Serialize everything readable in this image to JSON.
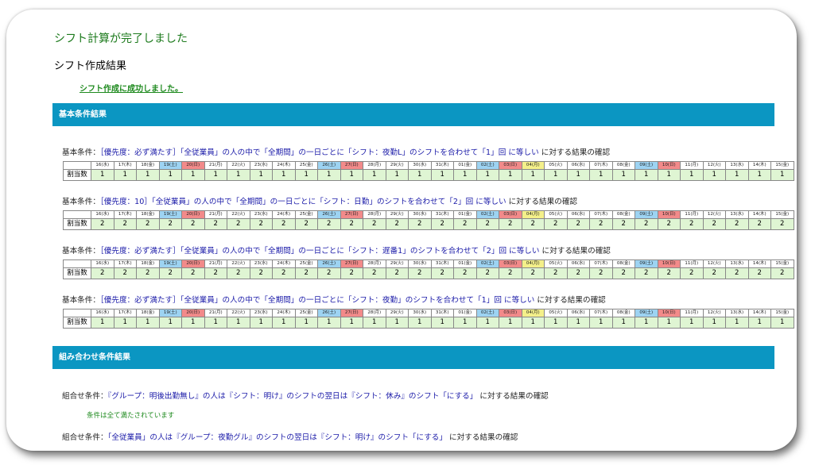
{
  "header": {
    "done": "シフト計算が完了しました",
    "result_title": "シフト作成結果",
    "success_link": "シフト作成に成功しました。"
  },
  "sections": {
    "basic": "基本条件結果",
    "combo": "組み合わせ条件結果"
  },
  "row_label": "割当数",
  "dates": [
    "16(水)",
    "17(木)",
    "18(金)",
    "19(土)",
    "20(日)",
    "21(月)",
    "22(火)",
    "23(水)",
    "24(木)",
    "25(金)",
    "26(土)",
    "27(日)",
    "28(月)",
    "29(火)",
    "30(水)",
    "31(木)",
    "01(金)",
    "02(土)",
    "03(日)",
    "04(月)",
    "05(火)",
    "06(水)",
    "07(木)",
    "08(金)",
    "09(土)",
    "10(日)",
    "11(月)",
    "12(火)",
    "13(水)",
    "14(木)",
    "15(金)"
  ],
  "day_colors": {
    "sat": [
      3,
      10,
      17,
      24
    ],
    "sun": [
      4,
      11,
      18,
      25
    ],
    "hol": [
      19
    ]
  },
  "colors": {
    "banner": "#0b96c2",
    "sat": "#9dd3f2",
    "sun": "#f28a8a",
    "holiday": "#f4f08a",
    "cell": "#dff5d3"
  },
  "basic_conditions": [
    {
      "prefix": "基本条件：",
      "priority": "［優先度：必ず満たす］",
      "body": "「全従業員」の人の中で「全期間」の一日ごとに「シフト：夜勤L」のシフトを合わせて「1」回 に等しい",
      "suffix": " に対する結果の確認",
      "values": [
        "1",
        "1",
        "1",
        "1",
        "1",
        "1",
        "1",
        "1",
        "1",
        "1",
        "1",
        "1",
        "1",
        "1",
        "1",
        "1",
        "1",
        "1",
        "1",
        "1",
        "1",
        "1",
        "1",
        "1",
        "1",
        "1",
        "1",
        "1",
        "1",
        "1",
        "1"
      ]
    },
    {
      "prefix": "基本条件：",
      "priority": "［優先度：10］",
      "body": "「全従業員」の人の中で「全期間」の一日ごとに「シフト：日勤」のシフトを合わせて「2」回 に等しい",
      "suffix": " に対する結果の確認",
      "values": [
        "2",
        "2",
        "2",
        "2",
        "2",
        "2",
        "2",
        "2",
        "2",
        "2",
        "2",
        "2",
        "2",
        "2",
        "2",
        "2",
        "2",
        "2",
        "2",
        "2",
        "2",
        "2",
        "2",
        "2",
        "2",
        "2",
        "2",
        "2",
        "2",
        "2",
        "2"
      ]
    },
    {
      "prefix": "基本条件：",
      "priority": "［優先度：必ず満たす］",
      "body": "「全従業員」の人の中で「全期間」の一日ごとに「シフト：遅番1」のシフトを合わせて「2」回 に等しい",
      "suffix": " に対する結果の確認",
      "values": [
        "2",
        "2",
        "2",
        "2",
        "2",
        "2",
        "2",
        "2",
        "2",
        "2",
        "2",
        "2",
        "2",
        "2",
        "2",
        "2",
        "2",
        "2",
        "2",
        "2",
        "2",
        "2",
        "2",
        "2",
        "2",
        "2",
        "2",
        "2",
        "2",
        "2",
        "2"
      ]
    },
    {
      "prefix": "基本条件：",
      "priority": "［優先度：必ず満たす］",
      "body": "「全従業員」の人の中で「全期間」の一日ごとに「シフト：夜勤」のシフトを合わせて「1」回 に等しい",
      "suffix": " に対する結果の確認",
      "values": [
        "1",
        "1",
        "1",
        "1",
        "1",
        "1",
        "1",
        "1",
        "1",
        "1",
        "1",
        "1",
        "1",
        "1",
        "1",
        "1",
        "1",
        "1",
        "1",
        "1",
        "1",
        "1",
        "1",
        "1",
        "1",
        "1",
        "1",
        "1",
        "1",
        "1",
        "1"
      ]
    }
  ],
  "combo_conditions": [
    {
      "prefix": "組合せ条件：",
      "body": "『グループ：明後出勤無し』の人は『シフト：明け』のシフトの翌日は『シフト：休み』のシフト「にする」",
      "suffix": " に対する結果の確認",
      "note": "条件は全て満たされています"
    },
    {
      "prefix": "組合せ条件：",
      "body": "「全従業員」の人は『グループ：夜勤グル』のシフトの翌日は『シフト：明け』のシフト「にする」",
      "suffix": " に対する結果の確認"
    }
  ]
}
